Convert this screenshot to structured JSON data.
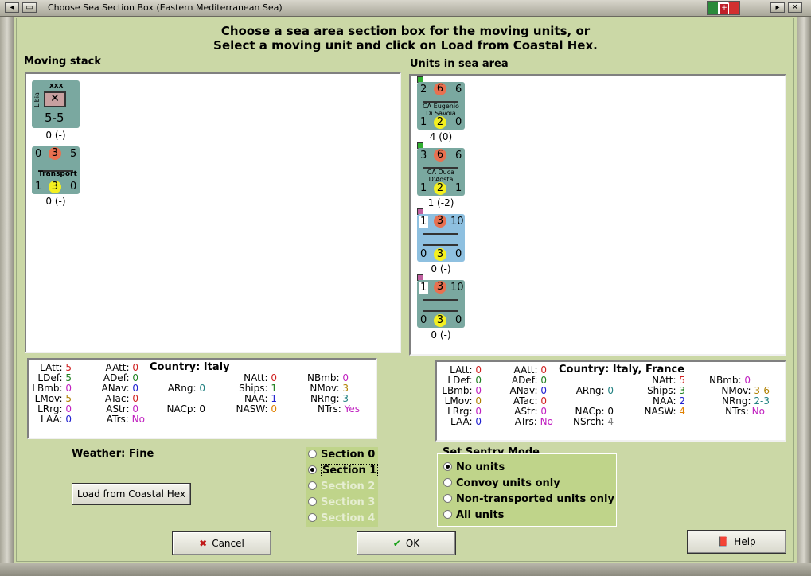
{
  "window": {
    "title": "Choose Sea Section Box (Eastern Mediterranean Sea)"
  },
  "instructions": {
    "line1": "Choose a sea area section box for the moving units, or",
    "line2": "Select a moving unit and click on Load from Coastal Hex."
  },
  "moving_stack": {
    "label": "Moving stack",
    "units": [
      {
        "tl": "",
        "tm": "xxx",
        "tr": "",
        "name": "Libia",
        "strength": "5-5",
        "bl": "",
        "bm": "",
        "br": "",
        "caption": "0 (-)",
        "color": "#7aa8a0"
      },
      {
        "tl": "0",
        "tm": "3",
        "tr": "5",
        "name": "Transport",
        "bl": "1",
        "bm": "3",
        "br": "0",
        "caption": "0 (-)",
        "color": "#7aa8a0"
      }
    ]
  },
  "sea_area": {
    "label": "Units in sea area",
    "units": [
      {
        "tl": "2",
        "tm": "6",
        "tr": "6",
        "name1": "CA Eugenio",
        "name2": "Di Savoia",
        "bl": "1",
        "bm": "2",
        "br": "0",
        "caption": "4 (0)",
        "color": "#7aa8a0",
        "marker": "#30b030"
      },
      {
        "tl": "3",
        "tm": "6",
        "tr": "6",
        "name1": "CA Duca D'Aosta",
        "name2": "",
        "bl": "1",
        "bm": "2",
        "br": "1",
        "caption": "1 (-2)",
        "color": "#7aa8a0",
        "marker": "#30b030"
      },
      {
        "tl": "1",
        "tm": "3",
        "tr": "10",
        "name1": "",
        "name2": "",
        "bl": "0",
        "bm": "3",
        "br": "0",
        "caption": "0 (-)",
        "color": "#8ec0e0",
        "marker": "#c060a0"
      },
      {
        "tl": "1",
        "tm": "3",
        "tr": "10",
        "name1": "",
        "name2": "",
        "bl": "0",
        "bm": "3",
        "br": "0",
        "caption": "0 (-)",
        "color": "#7aa8a0",
        "marker": "#c060a0"
      }
    ]
  },
  "stats_left": {
    "country": "Country: Italy",
    "items": [
      {
        "k": "LAtt:",
        "v": "5",
        "c": "#d02020"
      },
      {
        "k": "LDef:",
        "v": "5",
        "c": "#208020"
      },
      {
        "k": "LBmb:",
        "v": "0",
        "c": "#c020c0"
      },
      {
        "k": "LMov:",
        "v": "5",
        "c": "#b08000"
      },
      {
        "k": "LRrg:",
        "v": "0",
        "c": "#c020c0"
      },
      {
        "k": "LAA:",
        "v": "0",
        "c": "#2020d0"
      },
      {
        "k": "AAtt:",
        "v": "0",
        "c": "#d02020"
      },
      {
        "k": "ADef:",
        "v": "0",
        "c": "#208020"
      },
      {
        "k": "ANav:",
        "v": "0",
        "c": "#2020d0"
      },
      {
        "k": "ATac:",
        "v": "0",
        "c": "#d02020"
      },
      {
        "k": "AStr:",
        "v": "0",
        "c": "#c020c0"
      },
      {
        "k": "ATrs:",
        "v": "No",
        "c": "#c020c0"
      },
      {
        "k": "ARng:",
        "v": "0",
        "c": "#208080"
      },
      {
        "k": "NACp:",
        "v": "0",
        "c": "#000000"
      },
      {
        "k": "NAtt:",
        "v": "0",
        "c": "#d02020"
      },
      {
        "k": "Ships:",
        "v": "1",
        "c": "#208020"
      },
      {
        "k": "NAA:",
        "v": "1",
        "c": "#2020d0"
      },
      {
        "k": "NASW:",
        "v": "0",
        "c": "#e08000"
      },
      {
        "k": "NBmb:",
        "v": "0",
        "c": "#c020c0"
      },
      {
        "k": "NMov:",
        "v": "3",
        "c": "#b08000"
      },
      {
        "k": "NRng:",
        "v": "3",
        "c": "#208080"
      },
      {
        "k": "NTrs:",
        "v": "Yes",
        "c": "#c020c0"
      }
    ]
  },
  "stats_right": {
    "country": "Country: Italy, France",
    "items": [
      {
        "k": "LAtt:",
        "v": "0",
        "c": "#d02020"
      },
      {
        "k": "LDef:",
        "v": "0",
        "c": "#208020"
      },
      {
        "k": "LBmb:",
        "v": "0",
        "c": "#c020c0"
      },
      {
        "k": "LMov:",
        "v": "0",
        "c": "#b08000"
      },
      {
        "k": "LRrg:",
        "v": "0",
        "c": "#c020c0"
      },
      {
        "k": "LAA:",
        "v": "0",
        "c": "#2020d0"
      },
      {
        "k": "AAtt:",
        "v": "0",
        "c": "#d02020"
      },
      {
        "k": "ADef:",
        "v": "0",
        "c": "#208020"
      },
      {
        "k": "ANav:",
        "v": "0",
        "c": "#2020d0"
      },
      {
        "k": "ATac:",
        "v": "0",
        "c": "#d02020"
      },
      {
        "k": "AStr:",
        "v": "0",
        "c": "#c020c0"
      },
      {
        "k": "ATrs:",
        "v": "No",
        "c": "#c020c0"
      },
      {
        "k": "ARng:",
        "v": "0",
        "c": "#208080"
      },
      {
        "k": "NACp:",
        "v": "0",
        "c": "#000000"
      },
      {
        "k": "NSrch:",
        "v": "4",
        "c": "#808080"
      },
      {
        "k": "NAtt:",
        "v": "5",
        "c": "#d02020"
      },
      {
        "k": "Ships:",
        "v": "3",
        "c": "#208020"
      },
      {
        "k": "NAA:",
        "v": "2",
        "c": "#2020d0"
      },
      {
        "k": "NASW:",
        "v": "4",
        "c": "#e08000"
      },
      {
        "k": "NBmb:",
        "v": "0",
        "c": "#c020c0"
      },
      {
        "k": "NMov:",
        "v": "3-6",
        "c": "#b08000"
      },
      {
        "k": "NRng:",
        "v": "2-3",
        "c": "#208080"
      },
      {
        "k": "NTrs:",
        "v": "No",
        "c": "#c020c0"
      }
    ]
  },
  "weather": "Weather: Fine",
  "buttons": {
    "load": "Load from Coastal Hex",
    "cancel": "Cancel",
    "ok": "OK",
    "help": "Help"
  },
  "sections": [
    {
      "label": "Section 0",
      "enabled": true,
      "selected": false
    },
    {
      "label": "Section 1",
      "enabled": true,
      "selected": true
    },
    {
      "label": "Section 2",
      "enabled": false,
      "selected": false
    },
    {
      "label": "Section 3",
      "enabled": false,
      "selected": false
    },
    {
      "label": "Section 4",
      "enabled": false,
      "selected": false
    }
  ],
  "sentry": {
    "title": "Set Sentry Mode",
    "options": [
      {
        "label": "No units",
        "selected": true
      },
      {
        "label": "Convoy units only",
        "selected": false
      },
      {
        "label": "Non-transported units only",
        "selected": false
      },
      {
        "label": "All units",
        "selected": false
      }
    ]
  }
}
